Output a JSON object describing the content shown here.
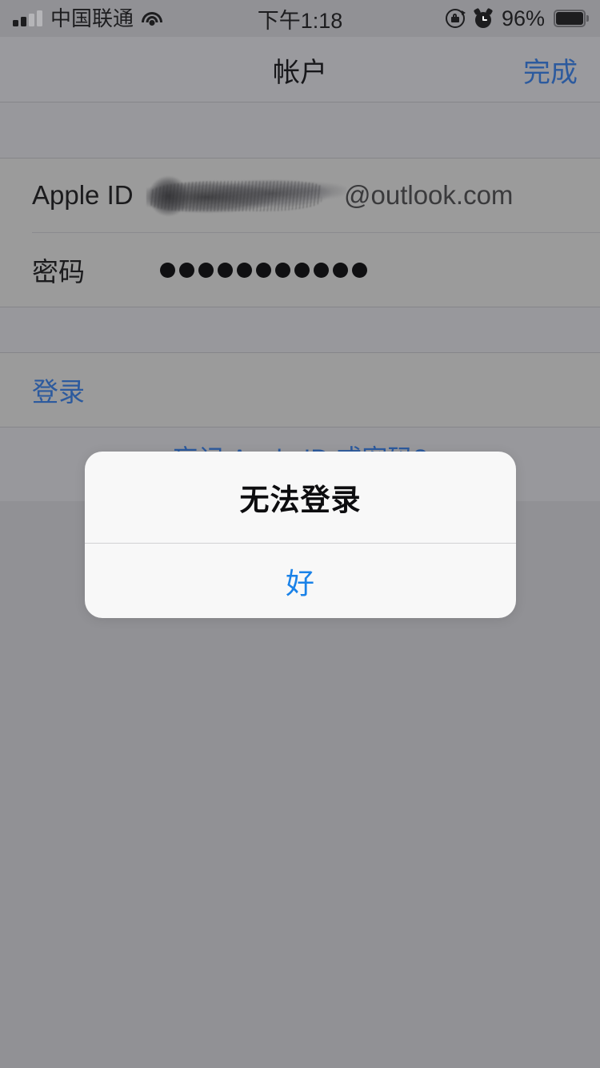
{
  "status_bar": {
    "carrier": "中国联通",
    "time": "下午1:18",
    "battery_percent": "96%",
    "signal_icon": "signal-bars-icon",
    "wifi_icon": "wifi-icon",
    "rotation_lock_icon": "rotation-lock-icon",
    "alarm_icon": "alarm-clock-icon",
    "battery_icon": "battery-icon"
  },
  "nav_bar": {
    "title": "帐户",
    "done_label": "完成"
  },
  "form": {
    "apple_id": {
      "label": "Apple ID",
      "value": "@outlook.com",
      "redacted": true
    },
    "password": {
      "label": "密码",
      "dot_count": 11
    },
    "sign_in_label": "登录",
    "forgot_label": "忘记 Apple ID 或密码?"
  },
  "alert": {
    "title": "无法登录",
    "ok_label": "好"
  },
  "colors": {
    "accent_blue": "#2c5a9e",
    "alert_blue": "#1a82e8",
    "dimmed_background": "#919195",
    "row_background": "#9b9b9b",
    "alert_background": "#f8f8f8"
  }
}
